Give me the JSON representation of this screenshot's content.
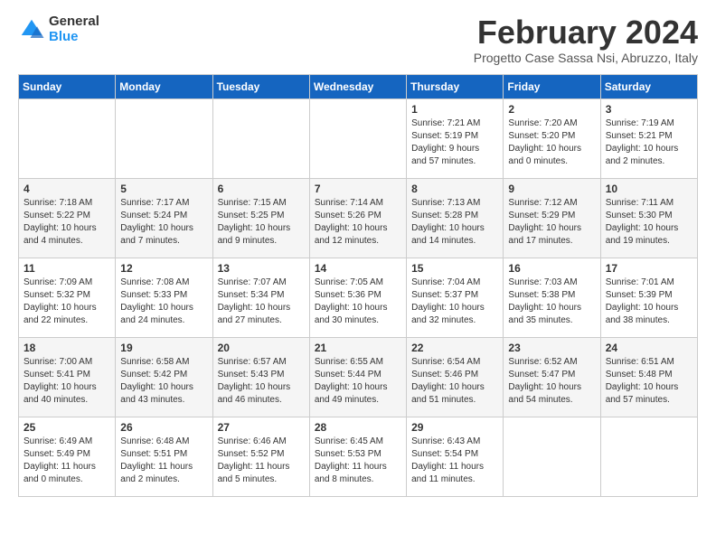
{
  "logo": {
    "general": "General",
    "blue": "Blue"
  },
  "header": {
    "title": "February 2024",
    "subtitle": "Progetto Case Sassa Nsi, Abruzzo, Italy"
  },
  "days_of_week": [
    "Sunday",
    "Monday",
    "Tuesday",
    "Wednesday",
    "Thursday",
    "Friday",
    "Saturday"
  ],
  "weeks": [
    [
      {
        "day": "",
        "info": ""
      },
      {
        "day": "",
        "info": ""
      },
      {
        "day": "",
        "info": ""
      },
      {
        "day": "",
        "info": ""
      },
      {
        "day": "1",
        "info": "Sunrise: 7:21 AM\nSunset: 5:19 PM\nDaylight: 9 hours\nand 57 minutes."
      },
      {
        "day": "2",
        "info": "Sunrise: 7:20 AM\nSunset: 5:20 PM\nDaylight: 10 hours\nand 0 minutes."
      },
      {
        "day": "3",
        "info": "Sunrise: 7:19 AM\nSunset: 5:21 PM\nDaylight: 10 hours\nand 2 minutes."
      }
    ],
    [
      {
        "day": "4",
        "info": "Sunrise: 7:18 AM\nSunset: 5:22 PM\nDaylight: 10 hours\nand 4 minutes."
      },
      {
        "day": "5",
        "info": "Sunrise: 7:17 AM\nSunset: 5:24 PM\nDaylight: 10 hours\nand 7 minutes."
      },
      {
        "day": "6",
        "info": "Sunrise: 7:15 AM\nSunset: 5:25 PM\nDaylight: 10 hours\nand 9 minutes."
      },
      {
        "day": "7",
        "info": "Sunrise: 7:14 AM\nSunset: 5:26 PM\nDaylight: 10 hours\nand 12 minutes."
      },
      {
        "day": "8",
        "info": "Sunrise: 7:13 AM\nSunset: 5:28 PM\nDaylight: 10 hours\nand 14 minutes."
      },
      {
        "day": "9",
        "info": "Sunrise: 7:12 AM\nSunset: 5:29 PM\nDaylight: 10 hours\nand 17 minutes."
      },
      {
        "day": "10",
        "info": "Sunrise: 7:11 AM\nSunset: 5:30 PM\nDaylight: 10 hours\nand 19 minutes."
      }
    ],
    [
      {
        "day": "11",
        "info": "Sunrise: 7:09 AM\nSunset: 5:32 PM\nDaylight: 10 hours\nand 22 minutes."
      },
      {
        "day": "12",
        "info": "Sunrise: 7:08 AM\nSunset: 5:33 PM\nDaylight: 10 hours\nand 24 minutes."
      },
      {
        "day": "13",
        "info": "Sunrise: 7:07 AM\nSunset: 5:34 PM\nDaylight: 10 hours\nand 27 minutes."
      },
      {
        "day": "14",
        "info": "Sunrise: 7:05 AM\nSunset: 5:36 PM\nDaylight: 10 hours\nand 30 minutes."
      },
      {
        "day": "15",
        "info": "Sunrise: 7:04 AM\nSunset: 5:37 PM\nDaylight: 10 hours\nand 32 minutes."
      },
      {
        "day": "16",
        "info": "Sunrise: 7:03 AM\nSunset: 5:38 PM\nDaylight: 10 hours\nand 35 minutes."
      },
      {
        "day": "17",
        "info": "Sunrise: 7:01 AM\nSunset: 5:39 PM\nDaylight: 10 hours\nand 38 minutes."
      }
    ],
    [
      {
        "day": "18",
        "info": "Sunrise: 7:00 AM\nSunset: 5:41 PM\nDaylight: 10 hours\nand 40 minutes."
      },
      {
        "day": "19",
        "info": "Sunrise: 6:58 AM\nSunset: 5:42 PM\nDaylight: 10 hours\nand 43 minutes."
      },
      {
        "day": "20",
        "info": "Sunrise: 6:57 AM\nSunset: 5:43 PM\nDaylight: 10 hours\nand 46 minutes."
      },
      {
        "day": "21",
        "info": "Sunrise: 6:55 AM\nSunset: 5:44 PM\nDaylight: 10 hours\nand 49 minutes."
      },
      {
        "day": "22",
        "info": "Sunrise: 6:54 AM\nSunset: 5:46 PM\nDaylight: 10 hours\nand 51 minutes."
      },
      {
        "day": "23",
        "info": "Sunrise: 6:52 AM\nSunset: 5:47 PM\nDaylight: 10 hours\nand 54 minutes."
      },
      {
        "day": "24",
        "info": "Sunrise: 6:51 AM\nSunset: 5:48 PM\nDaylight: 10 hours\nand 57 minutes."
      }
    ],
    [
      {
        "day": "25",
        "info": "Sunrise: 6:49 AM\nSunset: 5:49 PM\nDaylight: 11 hours\nand 0 minutes."
      },
      {
        "day": "26",
        "info": "Sunrise: 6:48 AM\nSunset: 5:51 PM\nDaylight: 11 hours\nand 2 minutes."
      },
      {
        "day": "27",
        "info": "Sunrise: 6:46 AM\nSunset: 5:52 PM\nDaylight: 11 hours\nand 5 minutes."
      },
      {
        "day": "28",
        "info": "Sunrise: 6:45 AM\nSunset: 5:53 PM\nDaylight: 11 hours\nand 8 minutes."
      },
      {
        "day": "29",
        "info": "Sunrise: 6:43 AM\nSunset: 5:54 PM\nDaylight: 11 hours\nand 11 minutes."
      },
      {
        "day": "",
        "info": ""
      },
      {
        "day": "",
        "info": ""
      }
    ]
  ]
}
